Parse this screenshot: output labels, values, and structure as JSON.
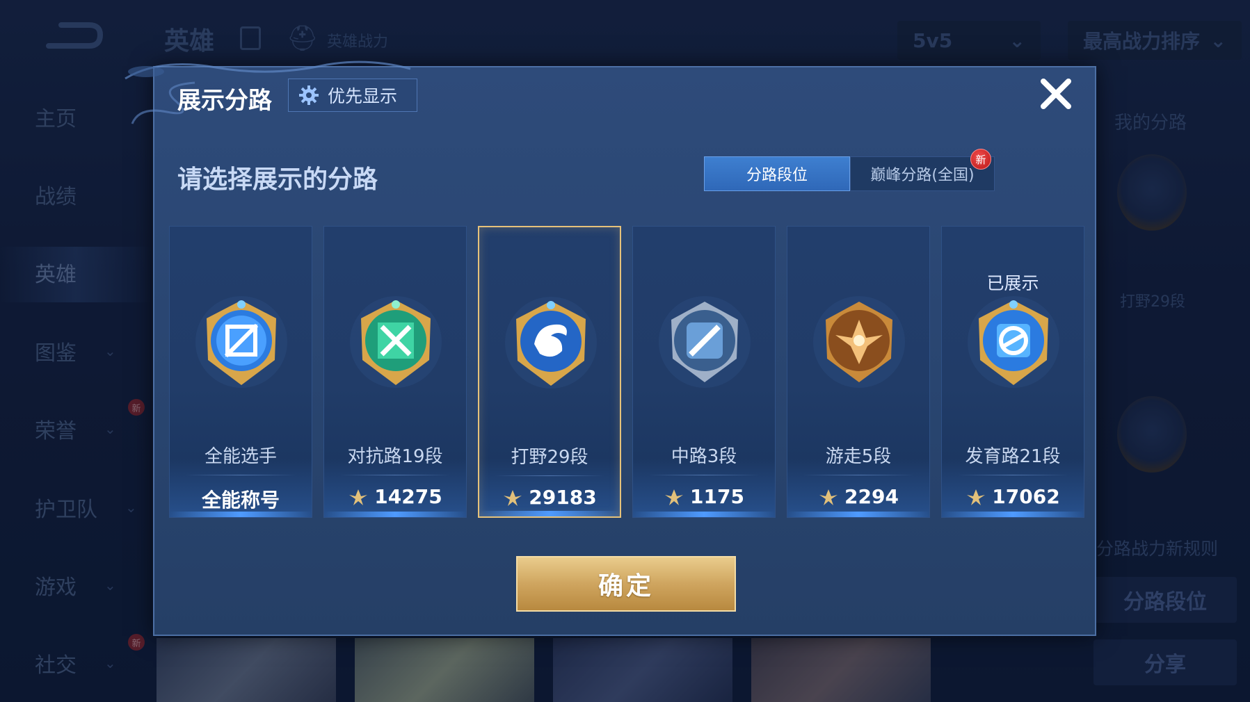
{
  "sidebar": {
    "items": [
      {
        "label": "主页"
      },
      {
        "label": "战绩"
      },
      {
        "label": "英雄"
      },
      {
        "label": "图鉴"
      },
      {
        "label": "荣誉"
      },
      {
        "label": "护卫队"
      },
      {
        "label": "游戏"
      },
      {
        "label": "社交"
      }
    ],
    "new_badge": "新"
  },
  "topbar": {
    "title": "英雄",
    "power_label": "英雄战力",
    "mode_select": "5v5",
    "sort_select": "最高战力排序"
  },
  "right_panel": {
    "my_lane": "我的分路",
    "lane_rank": "打野29段",
    "new_rule": "分路战力新规则",
    "lane_rank_button": "分路段位",
    "share_button": "分享"
  },
  "modal": {
    "title": "展示分路",
    "priority_button": "优先显示",
    "prompt": "请选择展示的分路",
    "tabs": [
      {
        "label": "分路段位",
        "active": true
      },
      {
        "label": "巅峰分路(全国)",
        "active": false,
        "badge": "新"
      }
    ],
    "cards": [
      {
        "name": "全能选手",
        "value": "全能称号",
        "selected": false,
        "shown": "",
        "icon": "all-round-emblem-icon"
      },
      {
        "name": "对抗路19段",
        "value": "14275",
        "selected": false,
        "shown": "",
        "icon": "clash-lane-emblem-icon"
      },
      {
        "name": "打野29段",
        "value": "29183",
        "selected": true,
        "shown": "",
        "icon": "jungle-emblem-icon"
      },
      {
        "name": "中路3段",
        "value": "1175",
        "selected": false,
        "shown": "",
        "icon": "mid-lane-emblem-icon"
      },
      {
        "name": "游走5段",
        "value": "2294",
        "selected": false,
        "shown": "",
        "icon": "roam-emblem-icon"
      },
      {
        "name": "发育路21段",
        "value": "17062",
        "selected": false,
        "shown": "已展示",
        "icon": "farm-lane-emblem-icon"
      }
    ],
    "confirm_button": "确定"
  },
  "colors": {
    "accent_blue": "#3e7fd0",
    "gold": "#e6c27a",
    "modal_bg": "#2e4b7a"
  }
}
